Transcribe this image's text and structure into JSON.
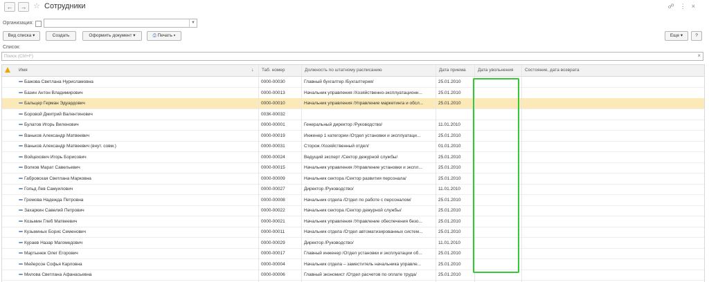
{
  "window": {
    "title": "Сотрудники",
    "back_icon": "arrow-left-icon",
    "forward_icon": "arrow-right-icon",
    "star_icon": "star-icon"
  },
  "filter": {
    "org_label": "Организация:",
    "org_value": ""
  },
  "toolbar": {
    "view_list": "Вид списка",
    "create": "Создать",
    "format_doc": "Оформить документ",
    "print": "Печать",
    "more": "Еще"
  },
  "list": {
    "label": "Список:",
    "search_placeholder": "Поиск (Ctrl+F)"
  },
  "table": {
    "headers": [
      "Имя",
      "Таб. номер",
      "Должность по штатному расписанию",
      "Дата приема",
      "Дата увольнения",
      "Состояние, дата возврата"
    ],
    "rows": [
      {
        "name": "Бажова Светлана Нурисламовна",
        "tab": "0000-00030",
        "pos": "Главный бухгалтер /Бухгалтерия/",
        "hire": "25.01.2010",
        "fire": "",
        "state": ""
      },
      {
        "name": "Базин Антон Владимирович",
        "tab": "0000-00013",
        "pos": "Начальник управления /Хозяйственно-эксплуатационн...",
        "hire": "25.01.2010",
        "fire": "",
        "state": ""
      },
      {
        "name": "Бальцер Герман Эдуардович",
        "tab": "0000-00010",
        "pos": "Начальник управления /Управление маркетинга и обсл...",
        "hire": "25.01.2010",
        "fire": "",
        "state": ""
      },
      {
        "name": "Боровой Дмитрий Валентинович",
        "tab": "003К-00032",
        "pos": "",
        "hire": "",
        "fire": "",
        "state": ""
      },
      {
        "name": "Булатов Игорь Виленович",
        "tab": "0000-00001",
        "pos": "Генеральный директор /Руководство/",
        "hire": "11.01.2010",
        "fire": "",
        "state": ""
      },
      {
        "name": "Ваньков Александр Матвеевич",
        "tab": "0000-00019",
        "pos": "Инженер 1 категории /Отдел установки и эксплуатаци...",
        "hire": "25.01.2010",
        "fire": "",
        "state": ""
      },
      {
        "name": "Ваньков Александр Матвеевич (внут. совм.)",
        "tab": "0000-00031",
        "pos": "Сторож /Хозяйственный отдел/",
        "hire": "01.01.2010",
        "fire": "",
        "state": ""
      },
      {
        "name": "Войцехович Игорь Борисович",
        "tab": "0000-00024",
        "pos": "Ведущий эксперт /Сектор дежурной службы/",
        "hire": "25.01.2010",
        "fire": "",
        "state": ""
      },
      {
        "name": "Волков Марат Савельевич",
        "tab": "0000-00015",
        "pos": "Начальник управления /Управление установки и экспл...",
        "hire": "25.01.2010",
        "fire": "",
        "state": ""
      },
      {
        "name": "Габровская Светлана Марковна",
        "tab": "0000-00009",
        "pos": "Начальник сектора /Сектор развития персонала/",
        "hire": "25.01.2010",
        "fire": "",
        "state": ""
      },
      {
        "name": "Гольд Лев Самуилович",
        "tab": "0000-00027",
        "pos": "Директор /Руководство/",
        "hire": "11.01.2010",
        "fire": "",
        "state": ""
      },
      {
        "name": "Громова Надежда Петровна",
        "tab": "0000-00008",
        "pos": "Начальник отдела /Отдел по работе с персоналом/",
        "hire": "25.01.2010",
        "fire": "",
        "state": ""
      },
      {
        "name": "Захаркин Савелий Петрович",
        "tab": "0000-00022",
        "pos": "Начальник сектора /Сектор дежурной службы/",
        "hire": "25.01.2010",
        "fire": "",
        "state": ""
      },
      {
        "name": "Козьмин Глеб Матвеевич",
        "tab": "0000-00021",
        "pos": "Начальник управления /Управление обеспечения безо...",
        "hire": "25.01.2010",
        "fire": "",
        "state": ""
      },
      {
        "name": "Кузьминых Борис Семенович",
        "tab": "0000-00011",
        "pos": "Начальник отдела /Отдел автоматизированных систем...",
        "hire": "25.01.2010",
        "fire": "",
        "state": ""
      },
      {
        "name": "Кураев Назар Магомедович",
        "tab": "0000-00029",
        "pos": "Директор /Руководство/",
        "hire": "11.01.2010",
        "fire": "",
        "state": ""
      },
      {
        "name": "Мартынюк Олег Егорович",
        "tab": "0000-00017",
        "pos": "Главный инженер /Отдел установки и эксплуатации об...",
        "hire": "25.01.2010",
        "fire": "",
        "state": ""
      },
      {
        "name": "Мейерсон Софья Карловна",
        "tab": "0000-00004",
        "pos": "Начальник отдела – заместитель начальника управле...",
        "hire": "25.01.2010",
        "fire": "",
        "state": ""
      },
      {
        "name": "Милова Светлана Афанасьевна",
        "tab": "0000-00006",
        "pos": "Главный экономист /Отдел расчетов по оплате труда/",
        "hire": "25.01.2010",
        "fire": "",
        "state": ""
      }
    ]
  },
  "colors": {
    "selected_row": "#fbe9b7",
    "highlight_box": "#35c736",
    "warning": "#e8a800"
  }
}
